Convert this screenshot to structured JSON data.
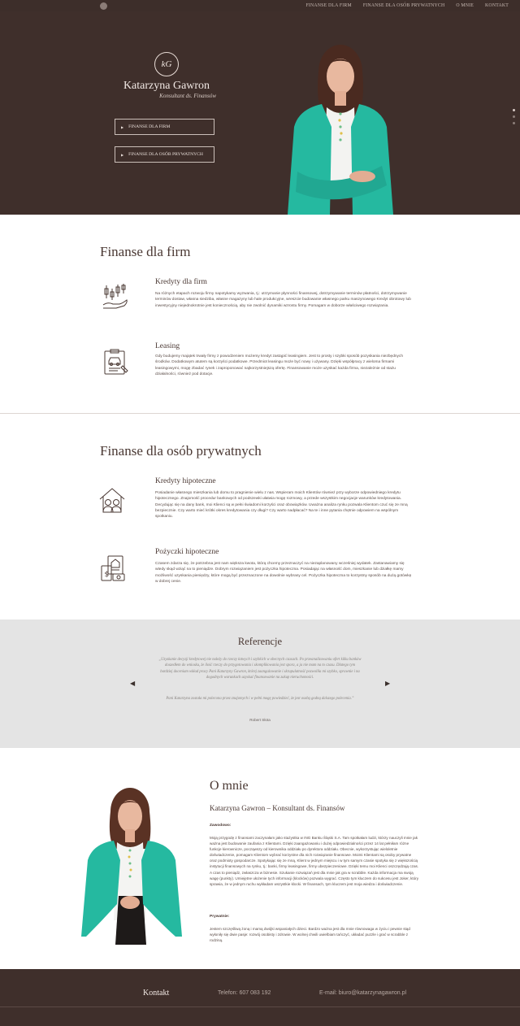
{
  "nav": {
    "items": [
      "FINANSE DLA FIRM",
      "FINANSE DLA OSÓB PRYWATNYCH",
      "O MNIE",
      "KONTAKT"
    ]
  },
  "hero": {
    "name": "Katarzyna Gawron",
    "subtitle": "Konsultant ds. Finansów",
    "monogram": "kG",
    "buttons": [
      "FINANSE DLA FIRM",
      "FINANSE DLA OSÓB PRYWATNYCH"
    ],
    "slide_dots": 3,
    "active_slide": 1
  },
  "firms": {
    "title": "Finanse dla firm",
    "items": [
      {
        "icon": "candlestick-chart-hand-icon",
        "title": "Kredyty dla firm",
        "text": "Na różnych etapach rozwoju firmy napotykamy wyzwania, tj.: utrzymanie płynności finansowej, dotrzymywanie terminów płatności, dotrzymywanie terminów dostaw, własna siedziba, własne magazyny lub hale produkcyjne, wreszcie budowanie własnego parku maszynowego Kredyt obrotowy lub inwestycyjny niejednokrotnie jest koniecznością, aby nie zwolnić dynamiki wzrostu firmy. Pomagam w doborze właściwego rozwiązania."
      },
      {
        "icon": "car-clipboard-icon",
        "title": "Leasing",
        "text": "Gdy budujemy majątek trwały firmy z powodzeniem możemy kredyt zastąpić leasingiem. Jest to prosty i szybki sposób pozyskania niezbędnych środków. Dodatkowym atutem są korzyści podatkowe. Przedmiot leasingu może być nowy i używany. Dzięki współpracy z wieloma firmami leasingowymi, mogę zbadać rynek i zaproponować najkorzystniejszą ofertę. Finansowanie może uzyskać każda firma, niezależnie od stażu działalności, również pod dotacje."
      }
    ]
  },
  "private": {
    "title": "Finanse dla osób prywatnych",
    "items": [
      {
        "icon": "house-family-icon",
        "title": "Kredyty hipoteczne",
        "text": "Posiadanie własnego mieszkania lub domu to pragnienie wielu z nas. Wspieram moich Klientów również przy wyborze odpowiedniego kredytu hipotecznego. Znajomość procedur bankowych od podszewki ułatwia mogę rozmowy, a przede wszystkim negocjacje warunków kredytowania. Decydując się na dany bank, moi Klienci są w pełni świadomi korzyści oraz obowiązków. Uważna analiza rynku pozwala Klientom czuć się ze mną bezpiecznie. Czy warto mieć krótki okres kredytowania czy długi? Czy warto nadpłacać? Na te i inne pytania chętnie odpowiem na wspólnym spotkaniu."
      },
      {
        "icon": "document-money-icon",
        "title": "Pożyczki hipoteczne",
        "text": "Czasem zdarza się, że potrzebna jest nam większa kwota, którą chcemy przeznaczyć na niezaplanowany wcześniej wydatek. Zastanawiamy się wtedy skąd wziąć na to pieniądze. Dobrym rozwiązaniem jest pożyczka hipoteczna. Posiadając na własność dom, mieszkanie lub działkę mamy możliwość uzyskania pieniędzy, które mogą być przeznaczone na dowolnie wybrany cel. Pożyczka hipoteczna to korzystny sposób na dużą gotówkę w dobrej cenie."
      }
    ]
  },
  "references": {
    "title": "Referencje",
    "quote": "„Uzyskanie decyzji kredytowej nie należy do rzeczy łatwych i szybkich w obecnych czasach. Po przeanalizowaniu ofert kilku banków doszedłem do wniosku, że ilość rzeczy do przygotowania i skomplikowania jest spora, a ja nie mam na to czasu. Dlatego tym bardziej doceniam wkład pracy Pani Katarzyny Gawron, której zaangażowanie i skrupulatność pozwoliła mi szybko, sprawnie i na dogodnych warunkach uzyskać finansowanie na zakup nieruchomości.",
    "quote2": "Pani Katarzyna została mi polecona przez znajomych i w pełni mogę powiedzieć, że jest osobą godną dalszego polecenia.”",
    "author": "Robert Słota",
    "prev": "◀",
    "next": "▶"
  },
  "about": {
    "title": "O mnie",
    "subtitle": "Katarzyna Gawron – Konsultant ds. Finansów",
    "label_work": "Zawodowo:",
    "text_work": "Moją przygodę z finansami zaczynałam jako stażystka w ING Banku Śląski S.A. Tam spotkałam ludzi, którzy nauczyli mnie jak ważna jest budowanie zaufania z Klientami. Dzięki zaangażowaniu i dużej odpowiedzialności przez 14 lat pełniłam różne funkcje kierownicze, począwszy od kierownika oddziału po dyrektora oddziału. Obecnie, wykorzystując wieloletnie doświadczenie, pomagam Klientom wybrać korzystne dla nich rozwiązanie finansowe. Moimi Klientami są osoby prywatne oraz podmioty gospodarcze. Spotykając się ze mną, Klient w jednym miejscu i w tym samym czasie spotyka się z większością instytucji finansowych na rynku, tj.: banki, firmy leasingowe, firmy ubezpieczeniowe. Dzięki temu moi Klienci oszczędzają czas. A czas to pieniądz, zwłaszcza w biznesie. Szukanie rozwiązań jest dla mnie jak gra w scrabble. Każda informacja ma swoją wagę (punkty). Umiejętne ułożenie tych informacji (klocków) pozwala wygrać. Często tym kluczem do sukcesu jest Joker, który sprawia, że w jednym ruchu wykładam wszystkie klocki. W finansach, tym kluczem jest moja wiedza i doświadczenie.",
    "label_private": "Prywatnie:",
    "text_private": "Jestem szczęśliwą żoną i mamą dwójki wspaniałych dzieci. Bardzo ważna jest dla mnie równowaga w życiu i pewnie stąd wyłoniły się dwie pasje: rozwój osobisty i zdrowie. W wolnej chwili uwielbiam tańczyć, układać puzzle i grać w scrabble z rodziną."
  },
  "footer": {
    "title": "Kontakt",
    "phone": "Telefon: 607 083 192",
    "email": "E-mail: biuro@katarzynagawron.pl"
  },
  "colors": {
    "dark_brown": "#3f2f2b",
    "teal": "#25b9a0",
    "grey_section": "#e4e4e4"
  }
}
